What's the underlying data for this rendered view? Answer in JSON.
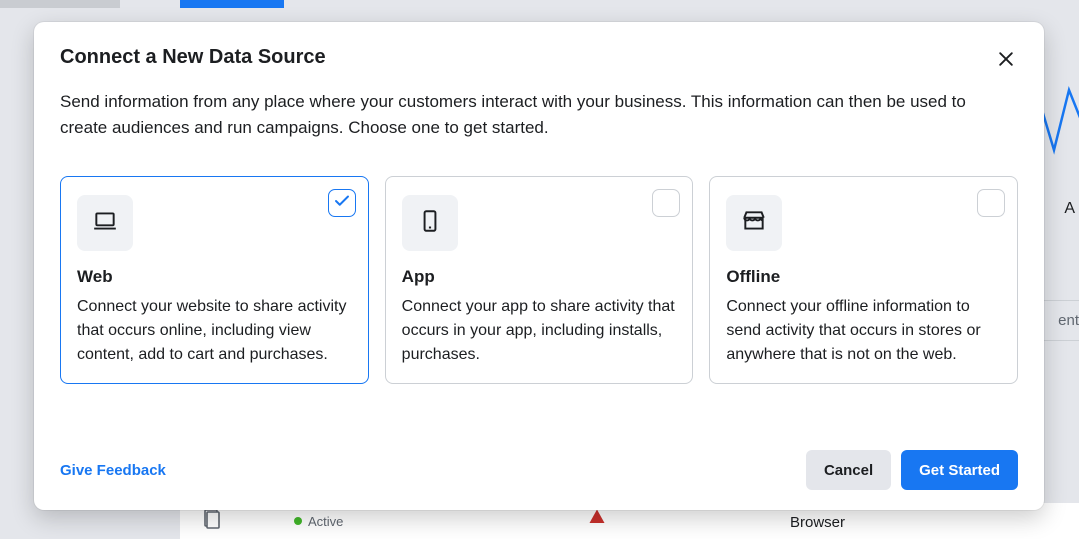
{
  "modal": {
    "title": "Connect a New Data Source",
    "subtitle": "Send information from any place where your customers interact with your business. This information can then be used to create audiences and run campaigns. Choose one to get started."
  },
  "cards": [
    {
      "id": "web",
      "title": "Web",
      "desc": "Connect your website to share activity that occurs online, including view content, add to cart and purchases.",
      "selected": true
    },
    {
      "id": "app",
      "title": "App",
      "desc": "Connect your app to share activity that occurs in your app, including installs, purchases.",
      "selected": false
    },
    {
      "id": "offline",
      "title": "Offline",
      "desc": "Connect your offline information to send activity that occurs in stores or anywhere that is not on the web.",
      "selected": false
    }
  ],
  "footer": {
    "feedback": "Give Feedback",
    "cancel": "Cancel",
    "primary": "Get Started"
  },
  "background": {
    "active_label": "Active",
    "browser_label": "Browser",
    "truncated_right": "ent",
    "letter": "A"
  }
}
